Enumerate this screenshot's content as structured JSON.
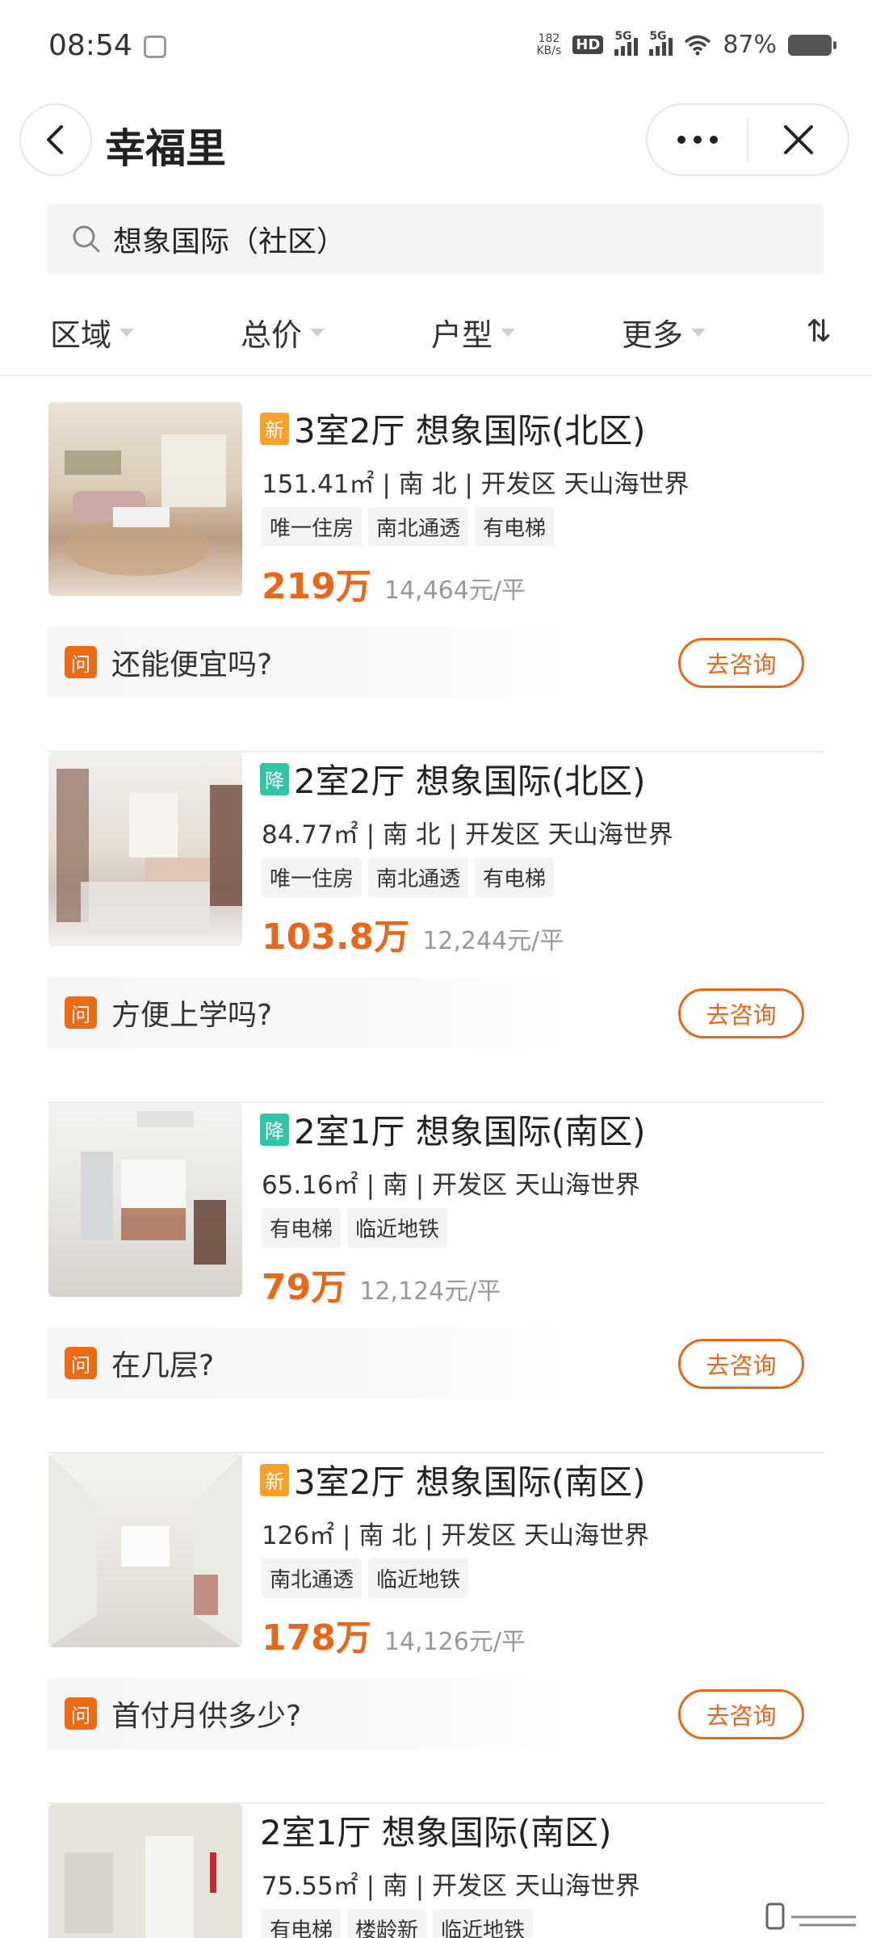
{
  "status_bar": {
    "time": "08:54",
    "net_speed_value": "182",
    "net_speed_unit": "KB/s",
    "hd_label": "HD",
    "signal_label_1": "5G",
    "signal_label_2": "5G",
    "battery_percent": "87%",
    "battery_level": 0.87
  },
  "header": {
    "title": "幸福里",
    "back_icon": "chevron-left-icon",
    "more_icon": "more-dots-icon",
    "close_icon": "close-icon"
  },
  "search": {
    "value": "想象国际（社区）",
    "icon": "search-icon"
  },
  "filters": {
    "items": [
      "区域",
      "总价",
      "户型",
      "更多"
    ],
    "sort_label": "⇅"
  },
  "listings": [
    {
      "badge": "新",
      "badge_color": "#f7a12b",
      "title": "3室2厅 想象国际(北区)",
      "meta": "151.41㎡ | 南 北 | 开发区 天山海世界",
      "tags": [
        "唯一住房",
        "南北通透",
        "有电梯"
      ],
      "price": "219万",
      "unit_price": "14,464元/平",
      "question": "还能便宜吗?",
      "consult_label": "去咨询"
    },
    {
      "badge": "降",
      "badge_color": "#2fc5a5",
      "title": "2室2厅 想象国际(北区)",
      "meta": "84.77㎡ | 南 北 | 开发区 天山海世界",
      "tags": [
        "唯一住房",
        "南北通透",
        "有电梯"
      ],
      "price": "103.8万",
      "unit_price": "12,244元/平",
      "question": "方便上学吗?",
      "consult_label": "去咨询"
    },
    {
      "badge": "降",
      "badge_color": "#2fc5a5",
      "title": "2室1厅 想象国际(南区)",
      "meta": "65.16㎡ | 南 | 开发区 天山海世界",
      "tags": [
        "有电梯",
        "临近地铁"
      ],
      "price": "79万",
      "unit_price": "12,124元/平",
      "question": "在几层?",
      "consult_label": "去咨询"
    },
    {
      "badge": "新",
      "badge_color": "#f7a12b",
      "title": "3室2厅 想象国际(南区)",
      "meta": "126㎡ | 南 北 | 开发区 天山海世界",
      "tags": [
        "南北通透",
        "临近地铁"
      ],
      "price": "178万",
      "unit_price": "14,126元/平",
      "question": "首付月供多少?",
      "consult_label": "去咨询"
    },
    {
      "badge": "",
      "title": "2室1厅 想象国际(南区)",
      "meta": "75.55㎡ | 南 | 开发区 天山海世界",
      "tags": [
        "有电梯",
        "楼龄新",
        "临近地铁"
      ],
      "price": "",
      "unit_price": "",
      "question": "",
      "consult_label": ""
    }
  ],
  "colors": {
    "accent": "#e8671b",
    "new_badge": "#f7a12b",
    "down_badge": "#2fc5a5"
  }
}
